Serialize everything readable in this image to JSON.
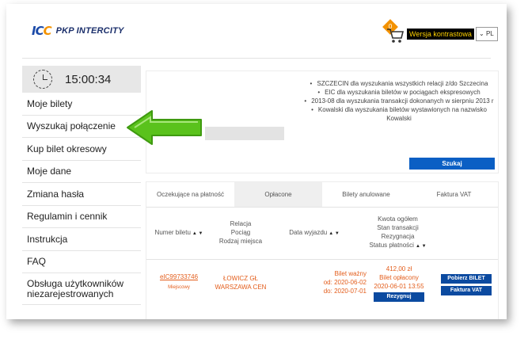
{
  "header": {
    "logo_mark": "IC",
    "logo_mark_accent": "C",
    "logo_text": "PKP INTERCITY",
    "cart_count": "0",
    "contrast_label": "Wersja kontrastowa",
    "language": "PL"
  },
  "sidebar": {
    "clock_time": "15:00:34",
    "items": [
      {
        "label": "Moje bilety"
      },
      {
        "label": "Wyszukaj połączenie"
      },
      {
        "label": "Kup bilet okresowy"
      },
      {
        "label": "Moje dane"
      },
      {
        "label": "Zmiana hasła"
      },
      {
        "label": "Regulamin i cennik"
      },
      {
        "label": "Instrukcja"
      },
      {
        "label": "FAQ"
      },
      {
        "label": "Obsługa użytkowników niezarejestrowanych"
      }
    ]
  },
  "search": {
    "hints": [
      "SZCZECIN dla wyszukania wszystkich relacji z/do Szczecina",
      "EIC dla wyszukania biletów w pociągach ekspresowych",
      "2013-08 dla wyszukania transakcji dokonanych w sierpniu 2013 r",
      "Kowalski dla wyszukania biletów wystawionych na nazwisko Kowalski"
    ],
    "button_label": "Szukaj"
  },
  "tickets": {
    "tabs": [
      {
        "label": "Oczekujące na płatność"
      },
      {
        "label": "Opłacone"
      },
      {
        "label": "Bilety anulowane"
      },
      {
        "label": "Faktura VAT"
      }
    ],
    "columns": {
      "ticket_number": "Numer biletu",
      "relation": "Relacja",
      "train": "Pociąg",
      "seat_type": "Rodzaj miejsca",
      "departure_date": "Data wyjazdu",
      "total": "Kwota ogółem",
      "transaction_status": "Stan transakcji",
      "resignation": "Rezygnacja",
      "payment_status": "Status płatności"
    },
    "rows": [
      {
        "ticket_number": "eIC99733746",
        "ticket_type": "Miejscowy",
        "from": "ŁOWICZ GŁ",
        "to": "WARSZAWA CEN",
        "validity": "Bilet ważny",
        "valid_from": "od: 2020-06-02",
        "valid_to": "do: 2020-07-01",
        "amount": "412,00 zł",
        "paid_status": "Bilet opłacony",
        "paid_date": "2020-06-01 13:55",
        "resign_label": "Rezygnuj",
        "download_label": "Pobierz BILET",
        "invoice_label": "Faktura VAT"
      }
    ]
  },
  "colors": {
    "accent_blue": "#0b5fc4",
    "arrow_green": "#5ac21c",
    "orange": "#e35d1b"
  }
}
